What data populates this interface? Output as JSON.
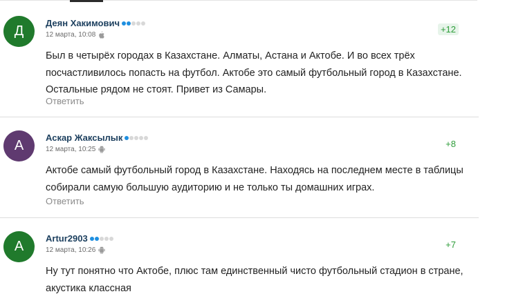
{
  "comments": [
    {
      "author": "Деян Хакимович",
      "avatar_letter": "Д",
      "avatar_color": "#207a2c",
      "rank_dots": [
        true,
        true,
        false,
        false,
        false
      ],
      "date": "12 марта, 10:08",
      "device_icon": "apple-icon",
      "score": "+12",
      "text": "Был в четырёх городах в Казахстане. Алматы, Астана и Актобе. И во всех трёх посчастливилось попасть на футбол. Актобе это самый футбольный город в Казахстане. Остальные рядом не стоят. Привет из Самары.",
      "reply_label": "Ответить"
    },
    {
      "author": "Аскар Жаксылык",
      "avatar_letter": "А",
      "avatar_color": "#5f3a70",
      "rank_dots": [
        true,
        false,
        false,
        false,
        false
      ],
      "date": "12 марта, 10:25",
      "device_icon": "android-icon",
      "score": "+8",
      "text": "Актобе самый футбольный город в Казахстане. Находясь на последнем месте в таблицы собирали самую большую аудиторию и не только ты домашних играх.",
      "reply_label": "Ответить"
    },
    {
      "author": "Artur2903",
      "avatar_letter": "А",
      "avatar_color": "#207a2c",
      "rank_dots": [
        true,
        true,
        false,
        false,
        false
      ],
      "date": "12 марта, 10:26",
      "device_icon": "android-icon",
      "score": "+7",
      "text": "Ну тут понятно что Актобе, плюс там единственный чисто футбольный стадион в стране, акустика классная",
      "reply_label": ""
    }
  ],
  "colors": {
    "author": "#1c3f5e",
    "score": "#2e9d3a",
    "rank_active": "#1e8fe0",
    "rank_inactive": "#d8d8d8"
  }
}
